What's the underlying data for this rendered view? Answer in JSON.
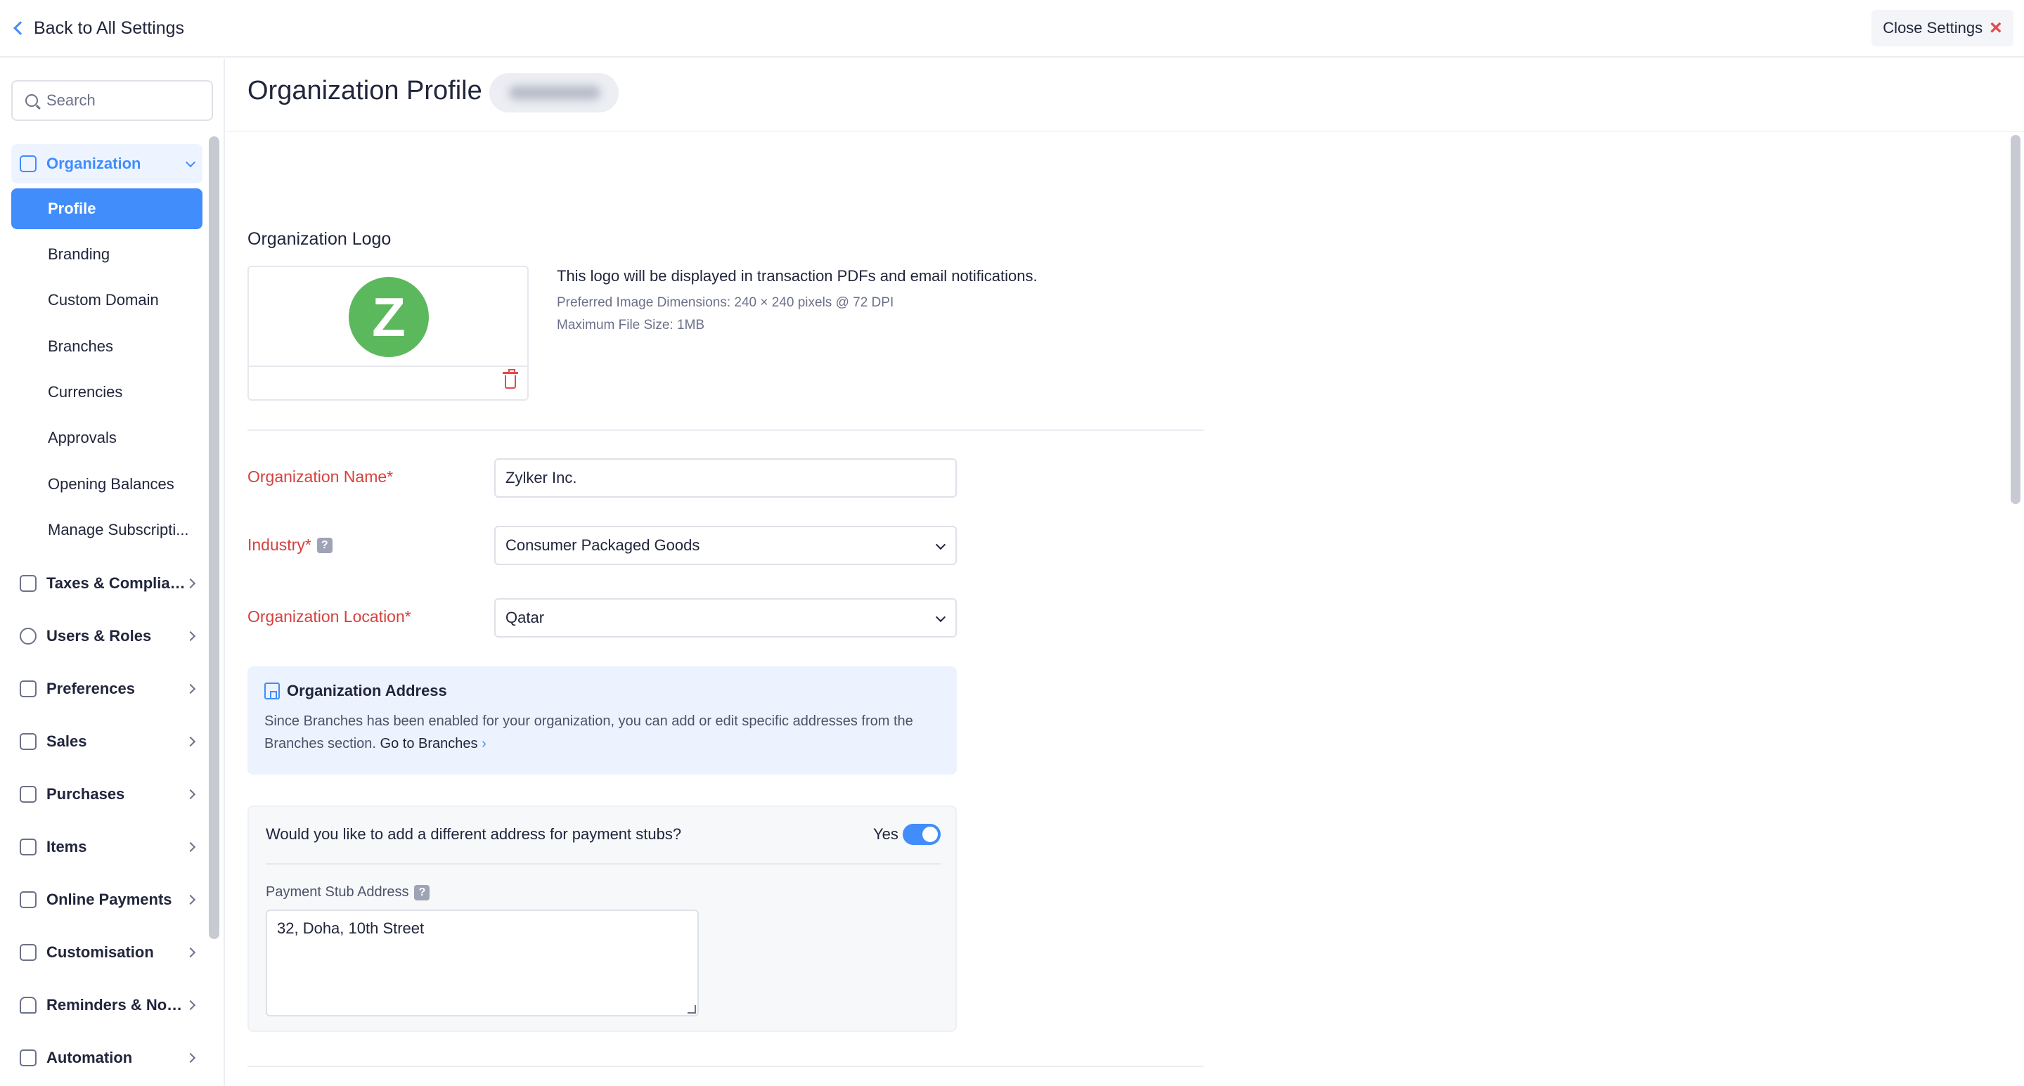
{
  "topbar": {
    "back_label": "Back to All Settings",
    "close_label": "Close Settings"
  },
  "sidebar": {
    "search_placeholder": "Search",
    "organization": {
      "label": "Organization",
      "items": [
        "Profile",
        "Branding",
        "Custom Domain",
        "Branches",
        "Currencies",
        "Approvals",
        "Opening Balances",
        "Manage Subscripti..."
      ],
      "active": "Profile"
    },
    "groups": [
      {
        "label": "Taxes & Complian...",
        "icon": "tax-doc-icon"
      },
      {
        "label": "Users & Roles",
        "icon": "users-icon"
      },
      {
        "label": "Preferences",
        "icon": "preferences-icon"
      },
      {
        "label": "Sales",
        "icon": "cart-icon"
      },
      {
        "label": "Purchases",
        "icon": "bag-icon"
      },
      {
        "label": "Items",
        "icon": "basket-icon"
      },
      {
        "label": "Online Payments",
        "icon": "card-icon"
      },
      {
        "label": "Customisation",
        "icon": "brush-icon"
      },
      {
        "label": "Reminders & Notifi...",
        "icon": "bell-icon"
      },
      {
        "label": "Automation",
        "icon": "lightning-icon"
      }
    ]
  },
  "main": {
    "page_title": "Organization Profile",
    "logo_section": {
      "label": "Organization Logo",
      "logo_letter": "Z",
      "info_main": "This logo will be displayed in transaction PDFs and email notifications.",
      "info_dimensions": "Preferred Image Dimensions: 240 × 240 pixels @ 72 DPI",
      "info_size": "Maximum File Size: 1MB"
    },
    "fields": {
      "org_name_label": "Organization Name*",
      "org_name_value": "Zylker Inc.",
      "industry_label": "Industry*",
      "industry_value": "Consumer Packaged Goods",
      "location_label": "Organization Location*",
      "location_value": "Qatar"
    },
    "address_card": {
      "title": "Organization Address",
      "desc": "Since Branches has been enabled for your organization, you can add or edit specific addresses from the Branches section.",
      "link": "Go to Branches",
      "link_arrow": "›"
    },
    "stub": {
      "question": "Would you like to add a different address for payment stubs?",
      "toggle_label": "Yes",
      "address_label": "Payment Stub Address",
      "address_value": "32, Doha, 10th Street"
    }
  },
  "colors": {
    "accent": "#408dfb",
    "required": "#d6413d",
    "logo_green": "#5cb85c"
  }
}
